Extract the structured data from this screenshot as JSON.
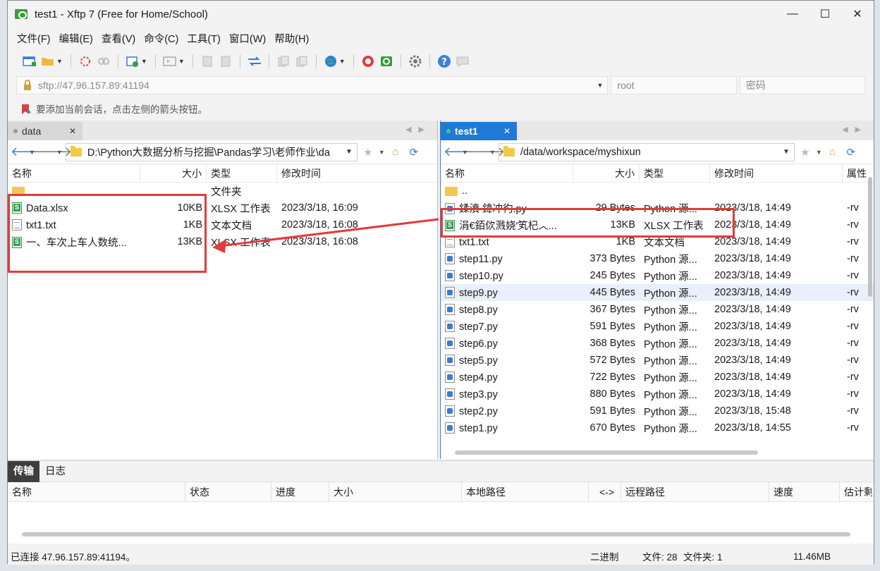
{
  "window": {
    "title": "test1 - Xftp 7 (Free for Home/School)",
    "minimize": "—",
    "maximize": "☐",
    "close": "✕"
  },
  "menu": [
    "文件(F)",
    "编辑(E)",
    "查看(V)",
    "命令(C)",
    "工具(T)",
    "窗口(W)",
    "帮助(H)"
  ],
  "address": {
    "host": "sftp://47.96.157.89:41194",
    "user": "root",
    "password_placeholder": "密码"
  },
  "hint": "要添加当前会话，点击左侧的箭头按钮。",
  "left_pane": {
    "tab_label": "data",
    "path": "D:\\Python大数据分析与挖掘\\Pandas学习\\老师作业\\da",
    "columns": [
      "名称",
      "大小",
      "类型",
      "修改时间"
    ],
    "rows": [
      {
        "icon": "folder",
        "name": "",
        "size": "",
        "type": "文件夹",
        "modified": ""
      },
      {
        "icon": "xlsx",
        "name": "Data.xlsx",
        "size": "10KB",
        "type": "XLSX 工作表",
        "modified": "2023/3/18, 16:09"
      },
      {
        "icon": "txt",
        "name": "txt1.txt",
        "size": "1KB",
        "type": "文本文档",
        "modified": "2023/3/18, 16:08"
      },
      {
        "icon": "xlsx",
        "name": "一、车次上车人数统...",
        "size": "13KB",
        "type": "XLSX 工作表",
        "modified": "2023/3/18, 16:08"
      }
    ]
  },
  "right_pane": {
    "tab_label": "test1",
    "path": "/data/workspace/myshixun",
    "columns": [
      "名称",
      "大小",
      "类型",
      "修改时间",
      "属性"
    ],
    "rows": [
      {
        "icon": "folder",
        "name": "..",
        "size": "",
        "type": "",
        "modified": "",
        "attr": ""
      },
      {
        "icon": "py",
        "name": "鍒濆   鍏冲彴.py",
        "size": "29 Bytes",
        "type": "Python 源...",
        "modified": "2023/3/18, 14:49",
        "attr": "-rv"
      },
      {
        "icon": "xlsx",
        "name": "涓€銆佽溅娆′笂杞︿...",
        "size": "13KB",
        "type": "XLSX 工作表",
        "modified": "2023/3/18, 14:49",
        "attr": "-rv"
      },
      {
        "icon": "txt",
        "name": "txt1.txt",
        "size": "1KB",
        "type": "文本文档",
        "modified": "2023/3/18, 14:49",
        "attr": "-rv"
      },
      {
        "icon": "py",
        "name": "step11.py",
        "size": "373 Bytes",
        "type": "Python 源...",
        "modified": "2023/3/18, 14:49",
        "attr": "-rv"
      },
      {
        "icon": "py",
        "name": "step10.py",
        "size": "245 Bytes",
        "type": "Python 源...",
        "modified": "2023/3/18, 14:49",
        "attr": "-rv"
      },
      {
        "icon": "py",
        "name": "step9.py",
        "size": "445 Bytes",
        "type": "Python 源...",
        "modified": "2023/3/18, 14:49",
        "attr": "-rv"
      },
      {
        "icon": "py",
        "name": "step8.py",
        "size": "367 Bytes",
        "type": "Python 源...",
        "modified": "2023/3/18, 14:49",
        "attr": "-rv"
      },
      {
        "icon": "py",
        "name": "step7.py",
        "size": "591 Bytes",
        "type": "Python 源...",
        "modified": "2023/3/18, 14:49",
        "attr": "-rv"
      },
      {
        "icon": "py",
        "name": "step6.py",
        "size": "368 Bytes",
        "type": "Python 源...",
        "modified": "2023/3/18, 14:49",
        "attr": "-rv"
      },
      {
        "icon": "py",
        "name": "step5.py",
        "size": "572 Bytes",
        "type": "Python 源...",
        "modified": "2023/3/18, 14:49",
        "attr": "-rv"
      },
      {
        "icon": "py",
        "name": "step4.py",
        "size": "722 Bytes",
        "type": "Python 源...",
        "modified": "2023/3/18, 14:49",
        "attr": "-rv"
      },
      {
        "icon": "py",
        "name": "step3.py",
        "size": "880 Bytes",
        "type": "Python 源...",
        "modified": "2023/3/18, 14:49",
        "attr": "-rv"
      },
      {
        "icon": "py",
        "name": "step2.py",
        "size": "591 Bytes",
        "type": "Python 源...",
        "modified": "2023/3/18, 15:48",
        "attr": "-rv"
      },
      {
        "icon": "py",
        "name": "step1.py",
        "size": "670 Bytes",
        "type": "Python 源...",
        "modified": "2023/3/18, 14:55",
        "attr": "-rv"
      }
    ],
    "selected_row": "step9.py"
  },
  "transfer": {
    "tabs": [
      "传输",
      "日志"
    ],
    "columns": [
      "名称",
      "状态",
      "进度",
      "大小",
      "本地路径",
      "<->",
      "远程路径",
      "速度",
      "估计剩"
    ]
  },
  "status": {
    "connection": "已连接 47.96.157.89:41194。",
    "mode": "二进制",
    "files": "文件: 28",
    "folders": "文件夹: 1",
    "size": "11.46MB"
  },
  "colors": {
    "accent": "#1e7ad6",
    "annotation": "#e23b3b"
  }
}
